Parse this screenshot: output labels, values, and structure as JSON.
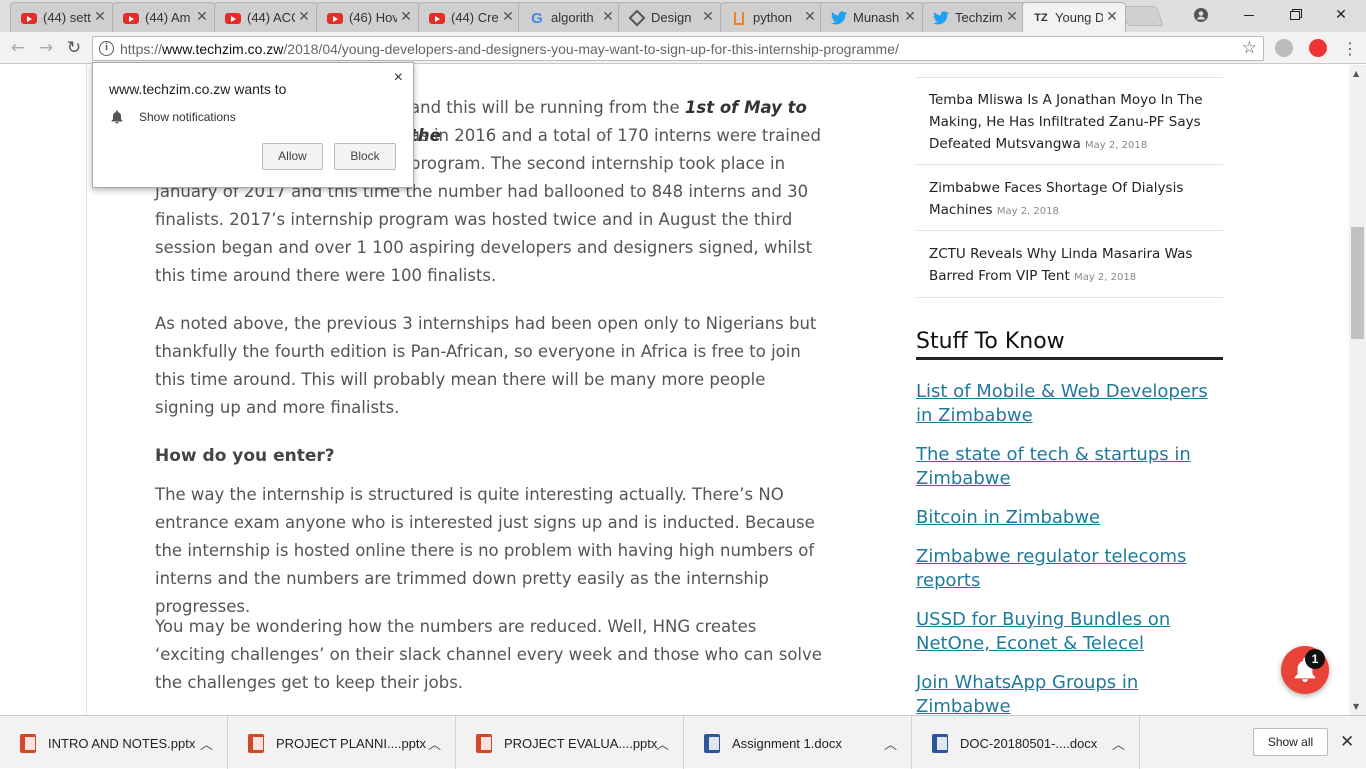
{
  "tabs": [
    {
      "title": "(44) sett",
      "icon": "youtube-icon"
    },
    {
      "title": "(44) Am",
      "icon": "youtube-icon"
    },
    {
      "title": "(44) ACC",
      "icon": "youtube-icon"
    },
    {
      "title": "(46) Hov",
      "icon": "youtube-icon"
    },
    {
      "title": "(44) Cre",
      "icon": "youtube-icon"
    },
    {
      "title": "algorith",
      "icon": "google-icon"
    },
    {
      "title": "Design",
      "icon": "design-icon"
    },
    {
      "title": "python",
      "icon": "stackoverflow-icon"
    },
    {
      "title": "Munash",
      "icon": "twitter-icon"
    },
    {
      "title": "Techzim",
      "icon": "twitter-icon"
    },
    {
      "title": "Young D",
      "icon": "techzim-icon",
      "favtext": "TZ"
    }
  ],
  "address_bar": {
    "url_prefix": "https://",
    "url_host": "www.techzim.co.zw",
    "url_path": "/2018/04/young-developers-and-designers-you-may-want-to-sign-up-for-this-internship-programme/"
  },
  "notification_prompt": {
    "title": "www.techzim.co.zw wants to",
    "permission": "Show notifications",
    "allow_label": "Allow",
    "block_label": "Block",
    "close_glyph": "×"
  },
  "article": {
    "p1_line1_before": "and this will be running from the",
    "p1_line1_em": "1st of May to the",
    "p1_line2": "as in 2016 and a total of 170 interns were trained",
    "p1_line3": "program. The second internship took place in",
    "p1_rest": "January of 2017 and this time the number had ballooned to 848 interns and 30 finalists. 2017’s internship program was hosted twice and in August the third session began and over 1 100 aspiring developers and designers signed, whilst this time around there were 100 finalists.",
    "p2": "As noted above, the previous 3 internships had been open only to Nigerians but thankfully the fourth edition is Pan-African, so everyone in Africa is free to join this time around. This will probably mean there will be many more people signing up and more finalists.",
    "heading": "How do you enter?",
    "p3": "The way the internship is structured is quite interesting actually. There’s NO entrance exam anyone who is interested just signs up and is inducted. Because the internship is hosted online there is no problem with having high numbers of interns and the numbers are trimmed down pretty easily as the internship progresses.",
    "p4": "You may be wondering how the numbers are reduced. Well, HNG creates ‘exciting challenges’ on their slack channel every week and those who can solve the challenges get to keep their jobs."
  },
  "sidebar": {
    "news": [
      {
        "title": "Temba Mliswa Is A Jonathan Moyo In The Making, He Has Infiltrated Zanu-PF Says Defeated Mutsvangwa",
        "date": "May 2, 2018"
      },
      {
        "title": "Zimbabwe Faces Shortage Of Dialysis Machines",
        "date": "May 2, 2018"
      },
      {
        "title": "ZCTU Reveals Why Linda Masarira Was Barred From VIP Tent",
        "date": "May 2, 2018"
      }
    ],
    "stuff_heading": "Stuff To Know",
    "stuff_links": [
      "List of Mobile & Web Developers in Zimbabwe",
      "The state of tech & startups in Zimbabwe",
      "Bitcoin in Zimbabwe",
      "Zimbabwe regulator telecoms reports",
      "USSD for Buying Bundles on NetOne, Econet & Telecel",
      "Join WhatsApp Groups in Zimbabwe"
    ]
  },
  "notification_badge": {
    "count": "1",
    "color": "#e8443a"
  },
  "downloads": [
    {
      "name": "INTRO AND NOTES.pptx",
      "type": "ppt"
    },
    {
      "name": "PROJECT PLANNI....pptx",
      "type": "ppt"
    },
    {
      "name": "PROJECT EVALUA....pptx",
      "type": "ppt"
    },
    {
      "name": "Assignment 1.docx",
      "type": "doc"
    },
    {
      "name": "DOC-20180501-....docx",
      "type": "doc"
    }
  ],
  "downloads_show_all": "Show all",
  "colors": {
    "link": "#1e7a9c",
    "youtube": "#e52d27",
    "twitter": "#1da1f2",
    "ppt": "#d24726",
    "doc": "#2b579a"
  }
}
